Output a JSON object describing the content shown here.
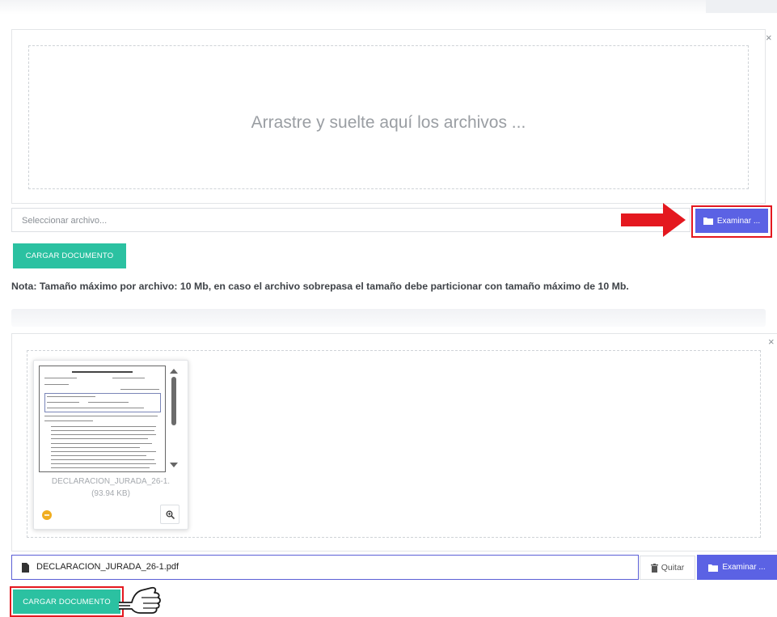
{
  "colors": {
    "primary_button": "#5b62e4",
    "upload_button": "#2bc1a1",
    "highlight": "#e4181f",
    "arrow": "#e4181f"
  },
  "upload_a": {
    "drop_caption": "Arrastre y suelte aquí los archivos ...",
    "file_placeholder": "Seleccionar archivo...",
    "browse_label": "Examinar ...",
    "upload_label": "CARGAR DOCUMENTO"
  },
  "note": "Nota: Tamaño máximo por archivo: 10 Mb, en caso el archivo sobrepasa el tamaño debe particionar con tamaño máximo de 10 Mb.",
  "upload_b": {
    "thumbnail": {
      "caption_name": "DECLARACION_JURADA_26-1.",
      "caption_size": "(93.94 KB)"
    },
    "selected_file": "DECLARACION_JURADA_26-1.pdf",
    "remove_label": "Quitar",
    "browse_label": "Examinar ...",
    "upload_label": "CARGAR DOCUMENTO"
  },
  "icons": [
    "close-icon",
    "folder-icon",
    "arrow-right-icon",
    "file-icon",
    "trash-icon",
    "zoom-icon",
    "upload-status-icon",
    "pointing-hand-icon"
  ]
}
